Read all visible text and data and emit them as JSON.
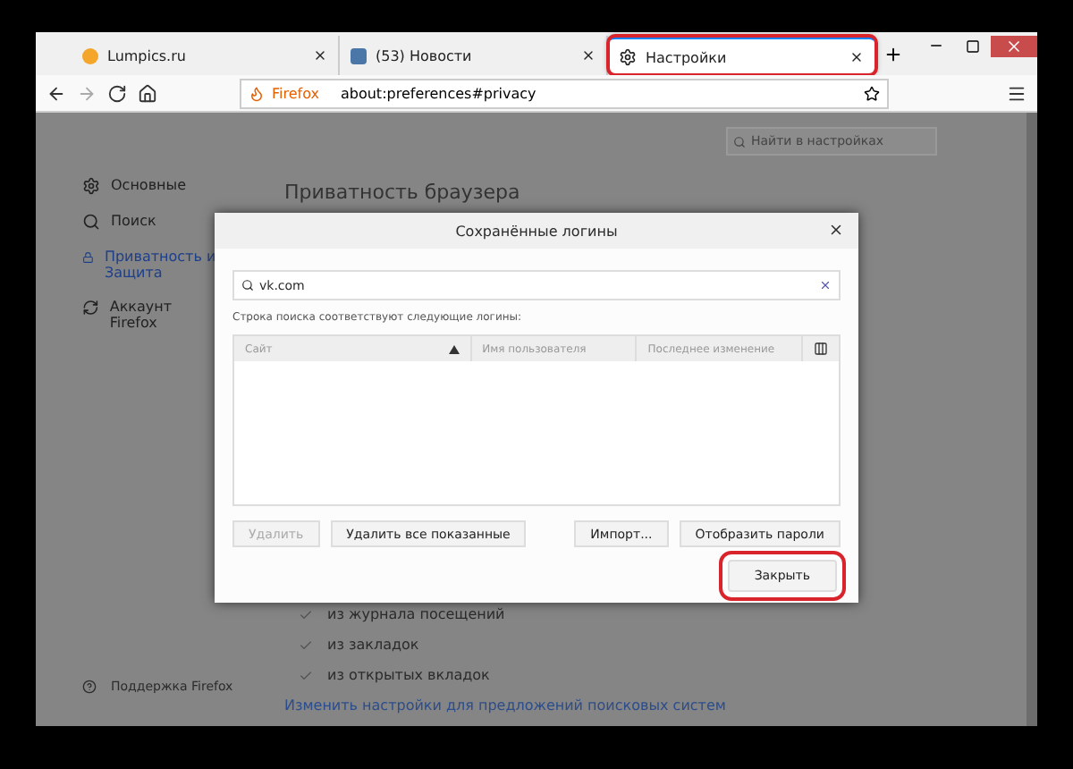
{
  "tabs": [
    {
      "label": "Lumpics.ru",
      "selected": false,
      "highlighted": false
    },
    {
      "label": "(53) Новости",
      "selected": false,
      "highlighted": false
    },
    {
      "label": "Настройки",
      "selected": true,
      "highlighted": true
    }
  ],
  "address_bar": {
    "identity": "Firefox",
    "url": "about:preferences#privacy"
  },
  "settings_search": {
    "placeholder": "Найти в настройках"
  },
  "sidebar": {
    "items": [
      {
        "label": "Основные",
        "selected": false
      },
      {
        "label": "Поиск",
        "selected": false
      },
      {
        "label": "Приватность и Защита",
        "selected": true
      },
      {
        "label": "Аккаунт Firefox",
        "selected": false
      }
    ],
    "footer": "Поддержка Firefox"
  },
  "page": {
    "heading": "Приватность браузера",
    "options": [
      {
        "label": "из журнала посещений",
        "checked": true
      },
      {
        "label": "из закладок",
        "checked": true
      },
      {
        "label": "из открытых вкладок",
        "checked": true
      }
    ],
    "link": "Изменить настройки для предложений поисковых систем"
  },
  "dialog": {
    "title": "Сохранённые логины",
    "search_value": "vk.com",
    "hint": "Строка поиска соответствуют следующие логины:",
    "columns": [
      {
        "label": "Сайт",
        "sorted": true
      },
      {
        "label": "Имя пользователя",
        "sorted": false
      },
      {
        "label": "Последнее изменение",
        "sorted": false
      }
    ],
    "buttons": [
      {
        "label": "Удалить",
        "disabled": true,
        "highlighted": false
      },
      {
        "label": "Удалить все показанные",
        "disabled": false,
        "highlighted": false
      },
      {
        "label": "Импорт...",
        "disabled": false,
        "highlighted": false
      },
      {
        "label": "Отобразить пароли",
        "disabled": false,
        "highlighted": false
      }
    ],
    "close_button": {
      "label": "Закрыть",
      "highlighted": true
    }
  }
}
